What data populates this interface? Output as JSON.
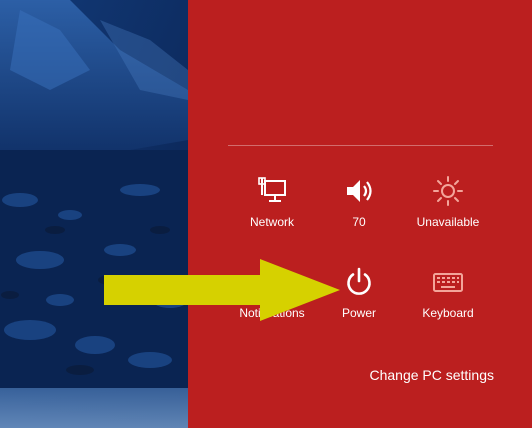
{
  "colors": {
    "charm_background": "#bb1f1f",
    "arrow": "#d6d100",
    "desktop_background": "#0d2a55",
    "text": "#ffffff"
  },
  "settings_charm": {
    "quick_settings": [
      {
        "id": "network",
        "label": "Network",
        "icon": "network-icon"
      },
      {
        "id": "volume",
        "label": "70",
        "icon": "speaker-volume-icon"
      },
      {
        "id": "brightness",
        "label": "Unavailable",
        "icon": "brightness-sun-icon"
      },
      {
        "id": "notifications",
        "label": "Notifications",
        "icon": "notifications-icon"
      },
      {
        "id": "power",
        "label": "Power",
        "icon": "power-icon"
      },
      {
        "id": "keyboard",
        "label": "Keyboard",
        "icon": "keyboard-icon"
      }
    ],
    "change_pc_settings_label": "Change PC settings"
  },
  "annotation": {
    "arrow_target": "power",
    "arrow_icon": "yellow-arrow-right"
  }
}
